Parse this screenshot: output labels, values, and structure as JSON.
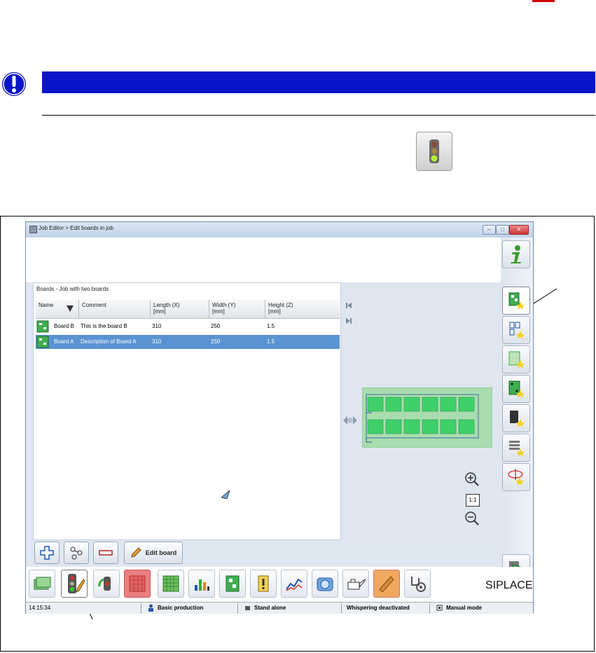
{
  "window": {
    "title": "Job Editor > Edit boards in job"
  },
  "window_controls": {
    "minimize": "–",
    "maximize": "□",
    "close": "✕"
  },
  "panel": {
    "title": "Boards - Job with two boards"
  },
  "table": {
    "columns": {
      "name": "Name",
      "comment": "Comment",
      "length": "Length (X)",
      "length_unit": "[mm]",
      "width": "Width (Y)",
      "width_unit": "[mm]",
      "height": "Height (Z)",
      "height_unit": "[mm]"
    },
    "rows": [
      {
        "name": "Board B",
        "comment": "This is the board B",
        "length": "310",
        "width": "250",
        "height": "1.5",
        "selected": false
      },
      {
        "name": "Board A",
        "comment": "Description of Board A",
        "length": "310",
        "width": "250",
        "height": "1.5",
        "selected": true
      }
    ]
  },
  "zoom": {
    "reset_label": "1:1"
  },
  "buttons": {
    "add": "add",
    "links": "links",
    "remove": "remove",
    "edit_board": "Edit board"
  },
  "brand": "SIPLACE",
  "status": {
    "time": "14:15:34",
    "mode": "Basic production",
    "line": "Stand alone",
    "whispering": "Whispering deactivated",
    "manual": "Manual mode"
  },
  "colors": {
    "doc_blue_bar": "#0a14c8",
    "selection": "#5a93d2",
    "board_green": "#3fae4f"
  }
}
